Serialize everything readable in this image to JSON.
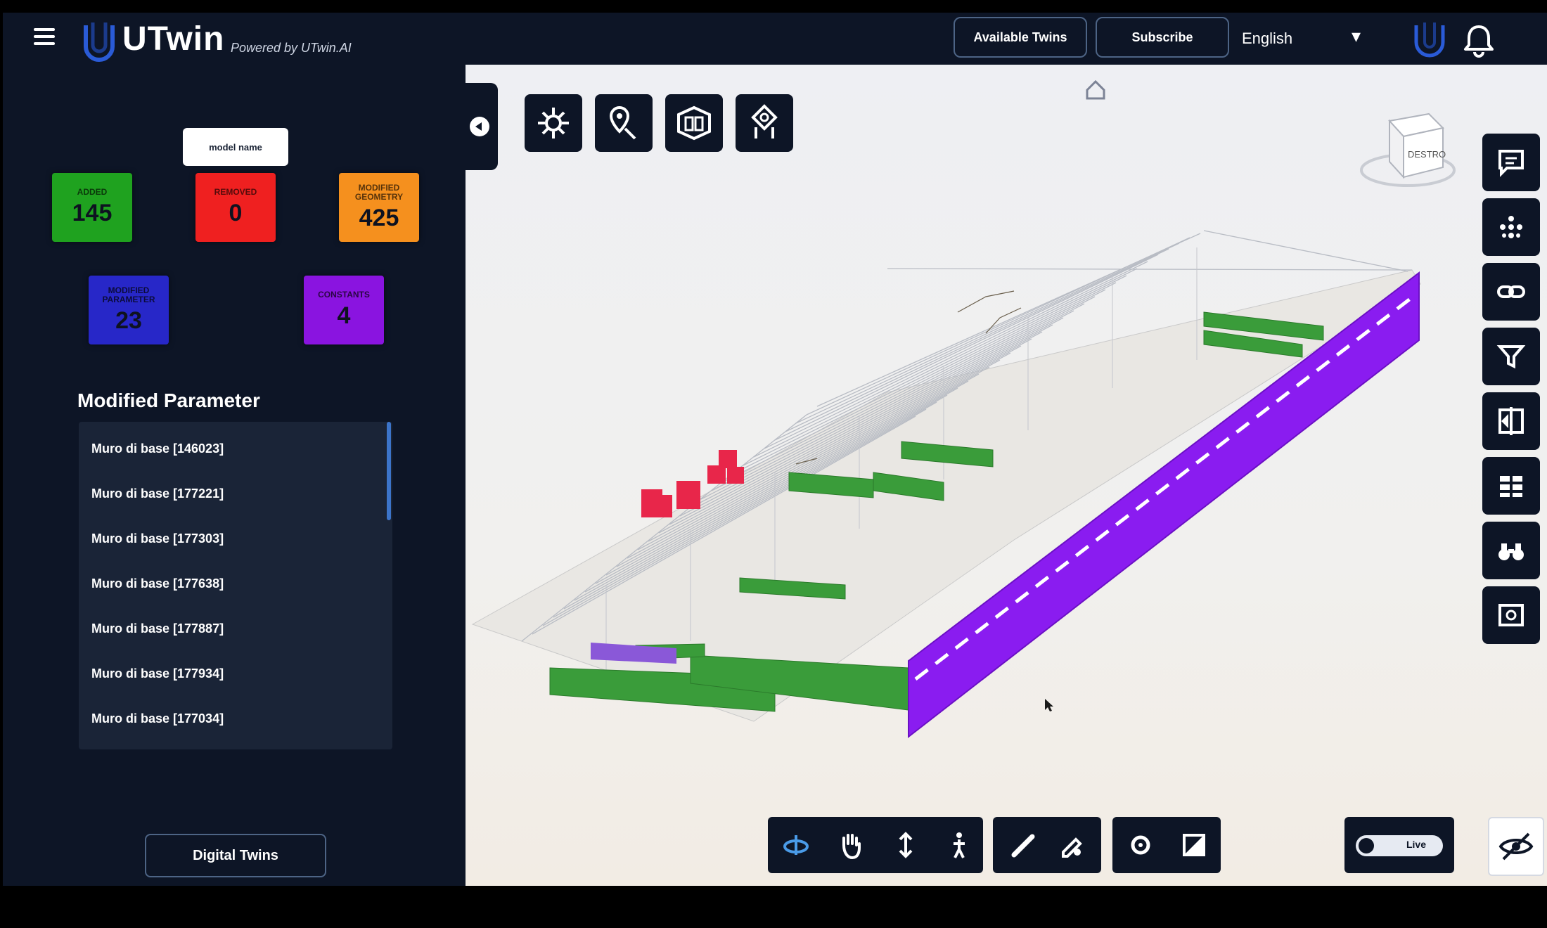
{
  "app": {
    "brand": "UTwin",
    "powered_by": "Powered by UTwin.AI"
  },
  "topbar": {
    "available_twins_label": "Available Twins",
    "subscribe_label": "Subscribe",
    "language": "English"
  },
  "sidebar": {
    "chip_label": "model name",
    "stats": [
      {
        "label": "ADDED",
        "value": "145",
        "color": "#1fa21f"
      },
      {
        "label": "REMOVED",
        "value": "0",
        "color": "#ef2020"
      },
      {
        "label": "MODIFIED GEOMETRY",
        "value": "425",
        "color": "#f5901e"
      },
      {
        "label": "MODIFIED PARAMETER",
        "value": "23",
        "color": "#2727c8"
      },
      {
        "label": "CONSTANTS",
        "value": "4",
        "color": "#8a14e0"
      }
    ],
    "section_title": "Modified Parameter",
    "items": [
      "Muro di base [146023]",
      "Muro di base [177221]",
      "Muro di base [177303]",
      "Muro di base [177638]",
      "Muro di base [177887]",
      "Muro di base [177934]",
      "Muro di base [177034]"
    ],
    "bottom_button_label": "Digital Twins"
  },
  "viewer": {
    "top_tools": [
      "network-settings-icon",
      "map-pin-icon",
      "model-view-icon",
      "compass-icon"
    ],
    "right_tools": [
      "comment-icon",
      "dots-grid-icon",
      "link-icon",
      "filter-icon",
      "compare-icon",
      "table-icon",
      "binoculars-icon",
      "screenshot-icon"
    ],
    "bottom_nav_tools": [
      "orbit-icon",
      "pan-icon",
      "zoom-icon",
      "walk-icon"
    ],
    "bottom_measure_tools": [
      "measure-icon",
      "markup-icon"
    ],
    "bottom_section_tools": [
      "section-plane-icon",
      "section-box-icon"
    ],
    "toggle_label": "Live",
    "navcube_label": "DESTRO",
    "accent_colors": {
      "added": "#2e9a2e",
      "removed": "#e8264a",
      "modified": "#8a1cf0"
    }
  }
}
